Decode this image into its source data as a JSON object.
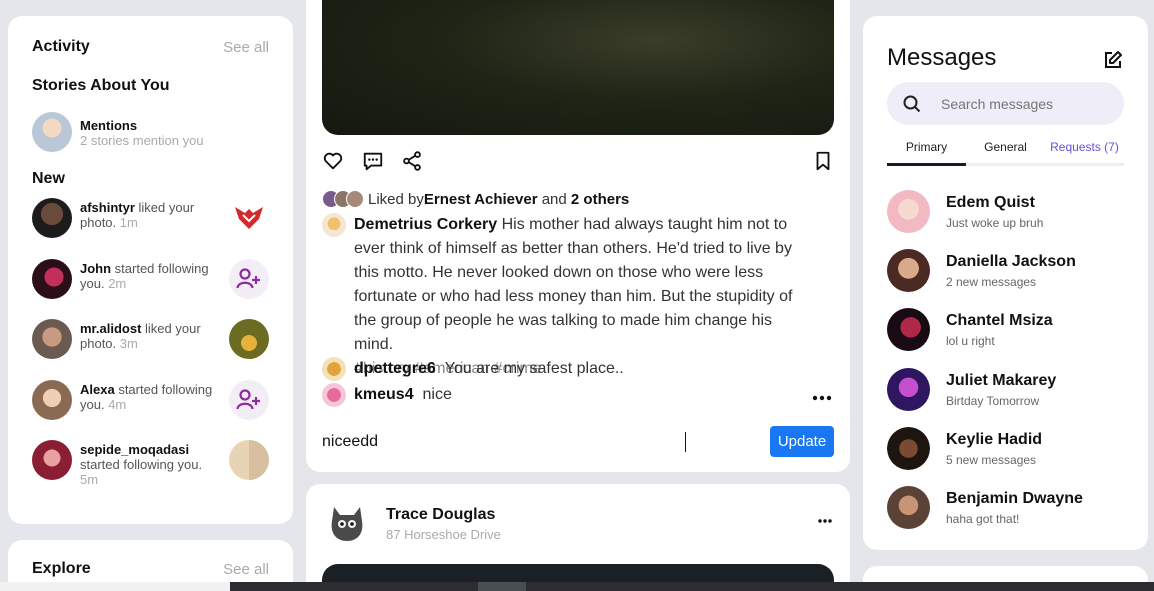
{
  "activity": {
    "title": "Activity",
    "see_all": "See all",
    "stories_title": "Stories About You",
    "mentions": {
      "name": "Mentions",
      "text": "2 stories mention you"
    },
    "new_title": "New",
    "items": [
      {
        "user": "afshintyr",
        "action": " liked your photo.",
        "time": " 1m",
        "thumb": "heart-logo-image"
      },
      {
        "user": "John",
        "action": " started following you.",
        "time": " 2m",
        "thumb": "follow-icon"
      },
      {
        "user": "mr.alidost",
        "action": " liked your photo.",
        "time": " 3m",
        "thumb": "photo-thumbnail"
      },
      {
        "user": "Alexa",
        "action": " started following you.",
        "time": " 4m",
        "thumb": "follow-icon"
      },
      {
        "user": "sepide_moqadasi",
        "action": " started following you.",
        "time": " 5m",
        "thumb": "photo-thumbnail"
      }
    ]
  },
  "explore": {
    "title": "Explore",
    "see_all": "See all"
  },
  "post": {
    "likes": {
      "prefix": "Liked by ",
      "user": "Ernest Achiever",
      "middle": " and ",
      "others": "2 others"
    },
    "caption": {
      "author": "Demetrius Corkery",
      "text": " His mother had always taught him not to ever think of himself as better than others. He'd tried to live by this motto. He never looked down on those who were less fortunate or who had less money than him. But the stupidity of the group of people he was talking to made him change his mind.",
      "hashtags": "#history #american #crime"
    },
    "comments": [
      {
        "user": "dpettegre6",
        "text": "You are my safest place.."
      },
      {
        "user": "kmeus4",
        "text": "nice"
      }
    ],
    "edit_value": "niceedd",
    "update_label": "Update"
  },
  "post2": {
    "author": "Trace Douglas",
    "location": "87 Horseshoe Drive"
  },
  "messages": {
    "title": "Messages",
    "search_placeholder": "Search messages",
    "tabs": [
      "Primary",
      "General",
      "Requests (7)"
    ],
    "list": [
      {
        "name": "Edem Quist",
        "preview": "Just woke up bruh"
      },
      {
        "name": "Daniella Jackson",
        "preview": "2 new messages"
      },
      {
        "name": "Chantel Msiza",
        "preview": "lol u right"
      },
      {
        "name": "Juliet Makarey",
        "preview": "Birtday Tomorrow"
      },
      {
        "name": "Keylie Hadid",
        "preview": "5 new messages"
      },
      {
        "name": "Benjamin Dwayne",
        "preview": "haha got that!"
      }
    ]
  },
  "colors": {
    "accent": "#1877f2",
    "requests": "#6a4fd8",
    "follow_icon": "#8e2b9e",
    "background": "#e4e6eb"
  }
}
